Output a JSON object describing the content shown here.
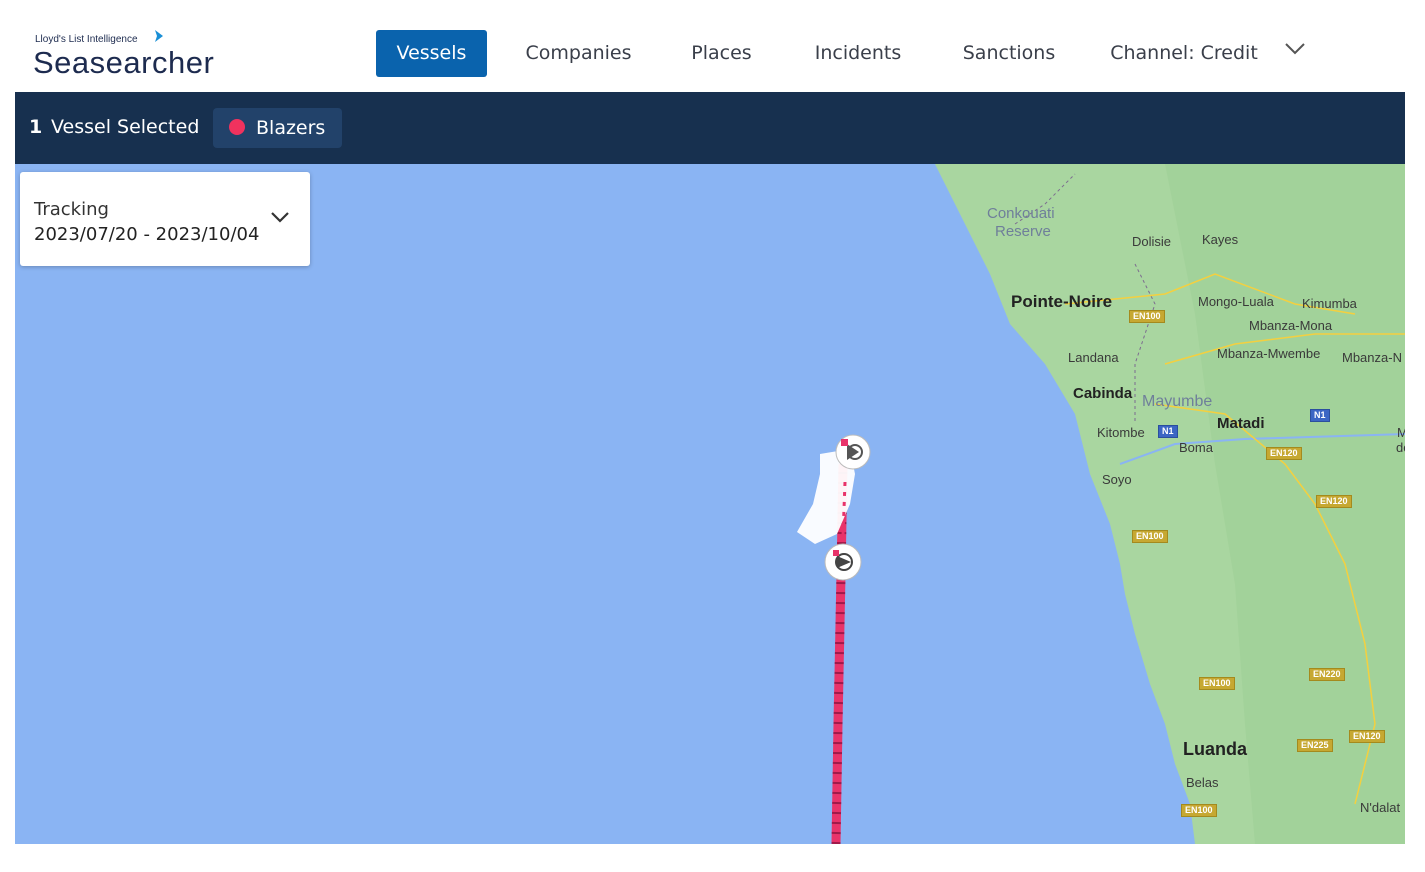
{
  "brand": {
    "subtitle": "Lloyd's List Intelligence",
    "title": "Seasearcher"
  },
  "nav": {
    "items": [
      "Vessels",
      "Companies",
      "Places",
      "Incidents",
      "Sanctions"
    ],
    "active": "Vessels",
    "channel": "Channel: Credit"
  },
  "selection": {
    "count": "1",
    "label": "Vessel Selected",
    "chip_label": "Blazers",
    "chip_color": "#f0325e"
  },
  "tracking": {
    "label": "Tracking",
    "range": "2023/07/20 - 2023/10/04"
  },
  "map": {
    "places": [
      "Conkouati",
      "Reserve",
      "Dolisie",
      "Kayes",
      "Pointe-Noire",
      "Mongo-Luala",
      "Kimumba",
      "Mbanza-Mona",
      "Landana",
      "Mbanza-Mwembe",
      "Mbanza-N",
      "Cabinda",
      "Mayumbe",
      "Matadi",
      "Kitombe",
      "Boma",
      "M",
      "do",
      "Soyo",
      "Luanda",
      "Belas",
      "N'dalat"
    ],
    "roads": [
      "EN100",
      "N1",
      "N1",
      "EN120",
      "EN120",
      "EN100",
      "EN220",
      "EN100",
      "EN225",
      "EN120",
      "EN100"
    ],
    "colors": {
      "ocean": "#8ab4f3",
      "land": "#a9d6a0",
      "track": "#e8336a"
    }
  }
}
